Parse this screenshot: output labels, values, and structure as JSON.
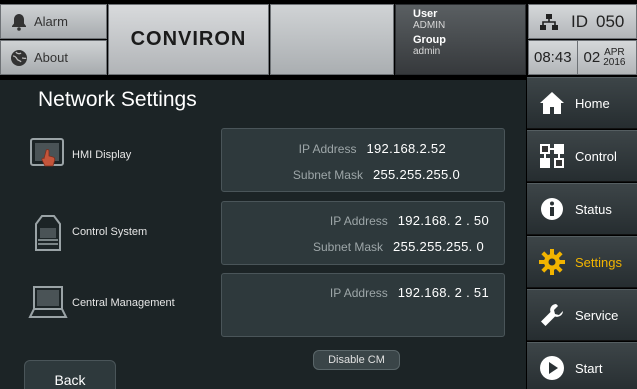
{
  "topbar": {
    "alarm_label": "Alarm",
    "about_label": "About",
    "logo": "CONVIRON",
    "user_label": "User",
    "user_value": "ADMIN",
    "group_label": "Group",
    "group_value": "admin",
    "id_label": "ID",
    "id_value": "050",
    "time": "08:43",
    "day": "02",
    "month": "APR",
    "year": "2016"
  },
  "page": {
    "title": "Network Settings",
    "rows": [
      {
        "label": "HMI Display",
        "ip_label": "IP Address",
        "ip": "192.168.2.52",
        "mask_label": "Subnet Mask",
        "mask": "255.255.255.0"
      },
      {
        "label": "Control System",
        "ip_label": "IP Address",
        "ip": "192.168. 2 . 50",
        "mask_label": "Subnet Mask",
        "mask": "255.255.255. 0"
      },
      {
        "label": "Central Management",
        "ip_label": "IP Address",
        "ip": "192.168. 2 . 51"
      }
    ],
    "disable_cm_label": "Disable CM",
    "back_label": "Back"
  },
  "nav": {
    "items": [
      {
        "label": "Home",
        "icon": "home-icon"
      },
      {
        "label": "Control",
        "icon": "control-icon"
      },
      {
        "label": "Status",
        "icon": "info-icon"
      },
      {
        "label": "Settings",
        "icon": "gear-icon"
      },
      {
        "label": "Service",
        "icon": "wrench-icon"
      },
      {
        "label": "Start",
        "icon": "play-icon"
      }
    ],
    "active": "Settings",
    "active_color": "#f2b400"
  }
}
